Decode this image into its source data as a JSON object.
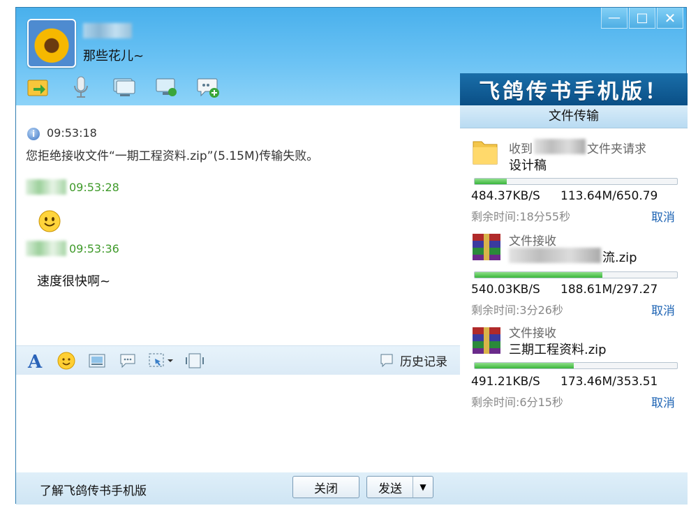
{
  "window": {
    "minimize_symbol": "—",
    "maximize_symbol": "□",
    "close_symbol": "✕"
  },
  "contact": {
    "signature": "那些花儿~"
  },
  "toolbar": {
    "icons": [
      "send-file-icon",
      "voice-icon",
      "video-icon",
      "remote-desktop-icon",
      "group-chat-icon"
    ]
  },
  "banner": {
    "text": "飞鸽传书手机版！"
  },
  "chat": {
    "messages": [
      {
        "time": "09:53:18",
        "text": "您拒绝接收文件“一期工程资料.zip”(5.15M)传输失败。"
      },
      {
        "time": "09:53:28",
        "text": ""
      },
      {
        "time": "09:53:36",
        "text": "速度很快啊~"
      }
    ]
  },
  "chat_toolbar": {
    "history_label": "历史记录"
  },
  "bottom": {
    "learn_link": "了解飞鸽传书手机版",
    "close_button": "关闭",
    "send_button": "发送",
    "send_dropdown": "▼"
  },
  "panel": {
    "title": "文件传输",
    "transfers": [
      {
        "label_prefix": "收到",
        "label_suffix": "文件夹请求",
        "name": "设计稿",
        "progress": 0.16,
        "speed": "484.37KB/S",
        "size": "113.64M/650.79",
        "remain": "剩余时间:18分55秒",
        "cancel": "取消"
      },
      {
        "label": "文件接收",
        "name": "流.zip",
        "progress": 0.63,
        "speed": "540.03KB/S",
        "size": "188.61M/297.27",
        "remain": "剩余时间:3分26秒",
        "cancel": "取消"
      },
      {
        "label": "文件接收",
        "name": "三期工程资料.zip",
        "progress": 0.49,
        "speed": "491.21KB/S",
        "size": "173.46M/353.51",
        "remain": "剩余时间:6分15秒",
        "cancel": "取消"
      }
    ]
  }
}
